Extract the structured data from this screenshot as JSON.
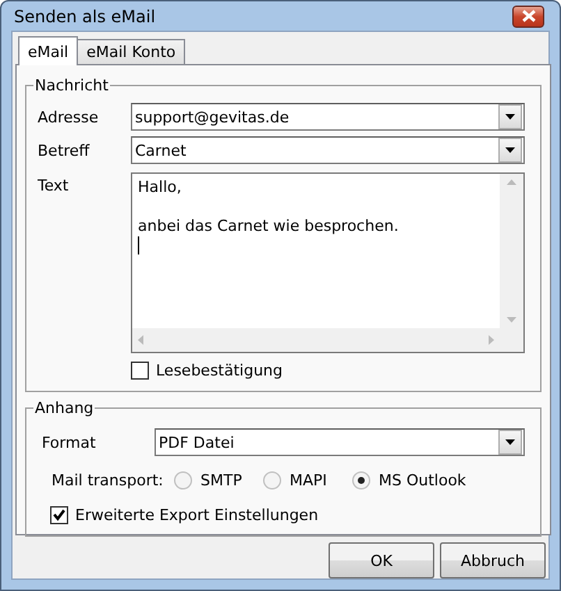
{
  "window": {
    "title": "Senden als eMail"
  },
  "tabs": [
    {
      "label": "eMail",
      "selected": true
    },
    {
      "label": "eMail Konto",
      "selected": false
    }
  ],
  "message": {
    "title": "Nachricht",
    "fields": [
      {
        "label": "Adresse",
        "value": "support@gevitas.de"
      },
      {
        "label": "Betreff",
        "value": "Carnet"
      }
    ],
    "text": {
      "label": "Text",
      "value": "Hallo,\n\nanbei das Carnet wie besprochen."
    },
    "read_receipt": {
      "label": "Lesebestätigung",
      "checked": false
    }
  },
  "attachment": {
    "title": "Anhang",
    "format": {
      "label": "Format",
      "value": "PDF Datei"
    },
    "transport": {
      "label": "Mail transport:",
      "options": [
        {
          "label": "SMTP",
          "selected": false
        },
        {
          "label": "MAPI",
          "selected": false
        },
        {
          "label": "MS Outlook",
          "selected": true
        }
      ]
    },
    "extended": {
      "label": "Erweiterte Export Einstellungen",
      "checked": true
    }
  },
  "buttons": [
    "OK",
    "Abbruch"
  ]
}
